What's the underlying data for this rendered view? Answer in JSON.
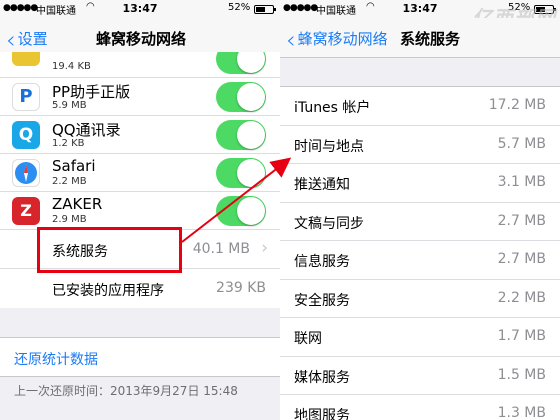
{
  "left": {
    "status": {
      "carrier": "中国联通",
      "time": "13:47",
      "battery": "52%"
    },
    "nav": {
      "back_label": "设置",
      "title": "蜂窝移动网络"
    },
    "apps": [
      {
        "name": "",
        "size": "19.4 KB",
        "icon": "app-icon-yellow",
        "color": "#e8c531"
      },
      {
        "name": "PP助手正版",
        "size": "5.9 MB",
        "icon": "pp-assistant-icon",
        "color": "#1a6fd6"
      },
      {
        "name": "QQ通讯录",
        "size": "1.2 KB",
        "icon": "qq-contacts-icon",
        "color": "#1aa7e8"
      },
      {
        "name": "Safari",
        "size": "2.2 MB",
        "icon": "safari-icon",
        "color": "#2b8ef0"
      },
      {
        "name": "ZAKER",
        "size": "2.9 MB",
        "icon": "zaker-icon",
        "color": "#d8252b"
      }
    ],
    "system_services": {
      "label": "系统服务",
      "value": "40.1 MB"
    },
    "installed_apps": {
      "label": "已安装的应用程序",
      "value": "239 KB"
    },
    "reset_label": "还原统计数据",
    "last_reset": "上一次还原时间：2013年9月27日 15:48"
  },
  "right": {
    "status": {
      "carrier": "中国联通",
      "time": "13:47",
      "battery": "52%"
    },
    "nav": {
      "back_label": "蜂窝移动网络",
      "title": "系统服务"
    },
    "watermark": "亿西部网",
    "services": [
      {
        "label": "iTunes 帐户",
        "value": "17.2 MB"
      },
      {
        "label": "时间与地点",
        "value": "5.7 MB"
      },
      {
        "label": "推送通知",
        "value": "3.1 MB"
      },
      {
        "label": "文稿与同步",
        "value": "2.7 MB"
      },
      {
        "label": "信息服务",
        "value": "2.7 MB"
      },
      {
        "label": "安全服务",
        "value": "2.2 MB"
      },
      {
        "label": "联网",
        "value": "1.7 MB"
      },
      {
        "label": "媒体服务",
        "value": "1.5 MB"
      },
      {
        "label": "地图服务",
        "value": "1.3 MB"
      }
    ]
  },
  "colors": {
    "accent": "#1a7cf5",
    "toggle_on": "#4cd964",
    "highlight": "#e60012"
  }
}
